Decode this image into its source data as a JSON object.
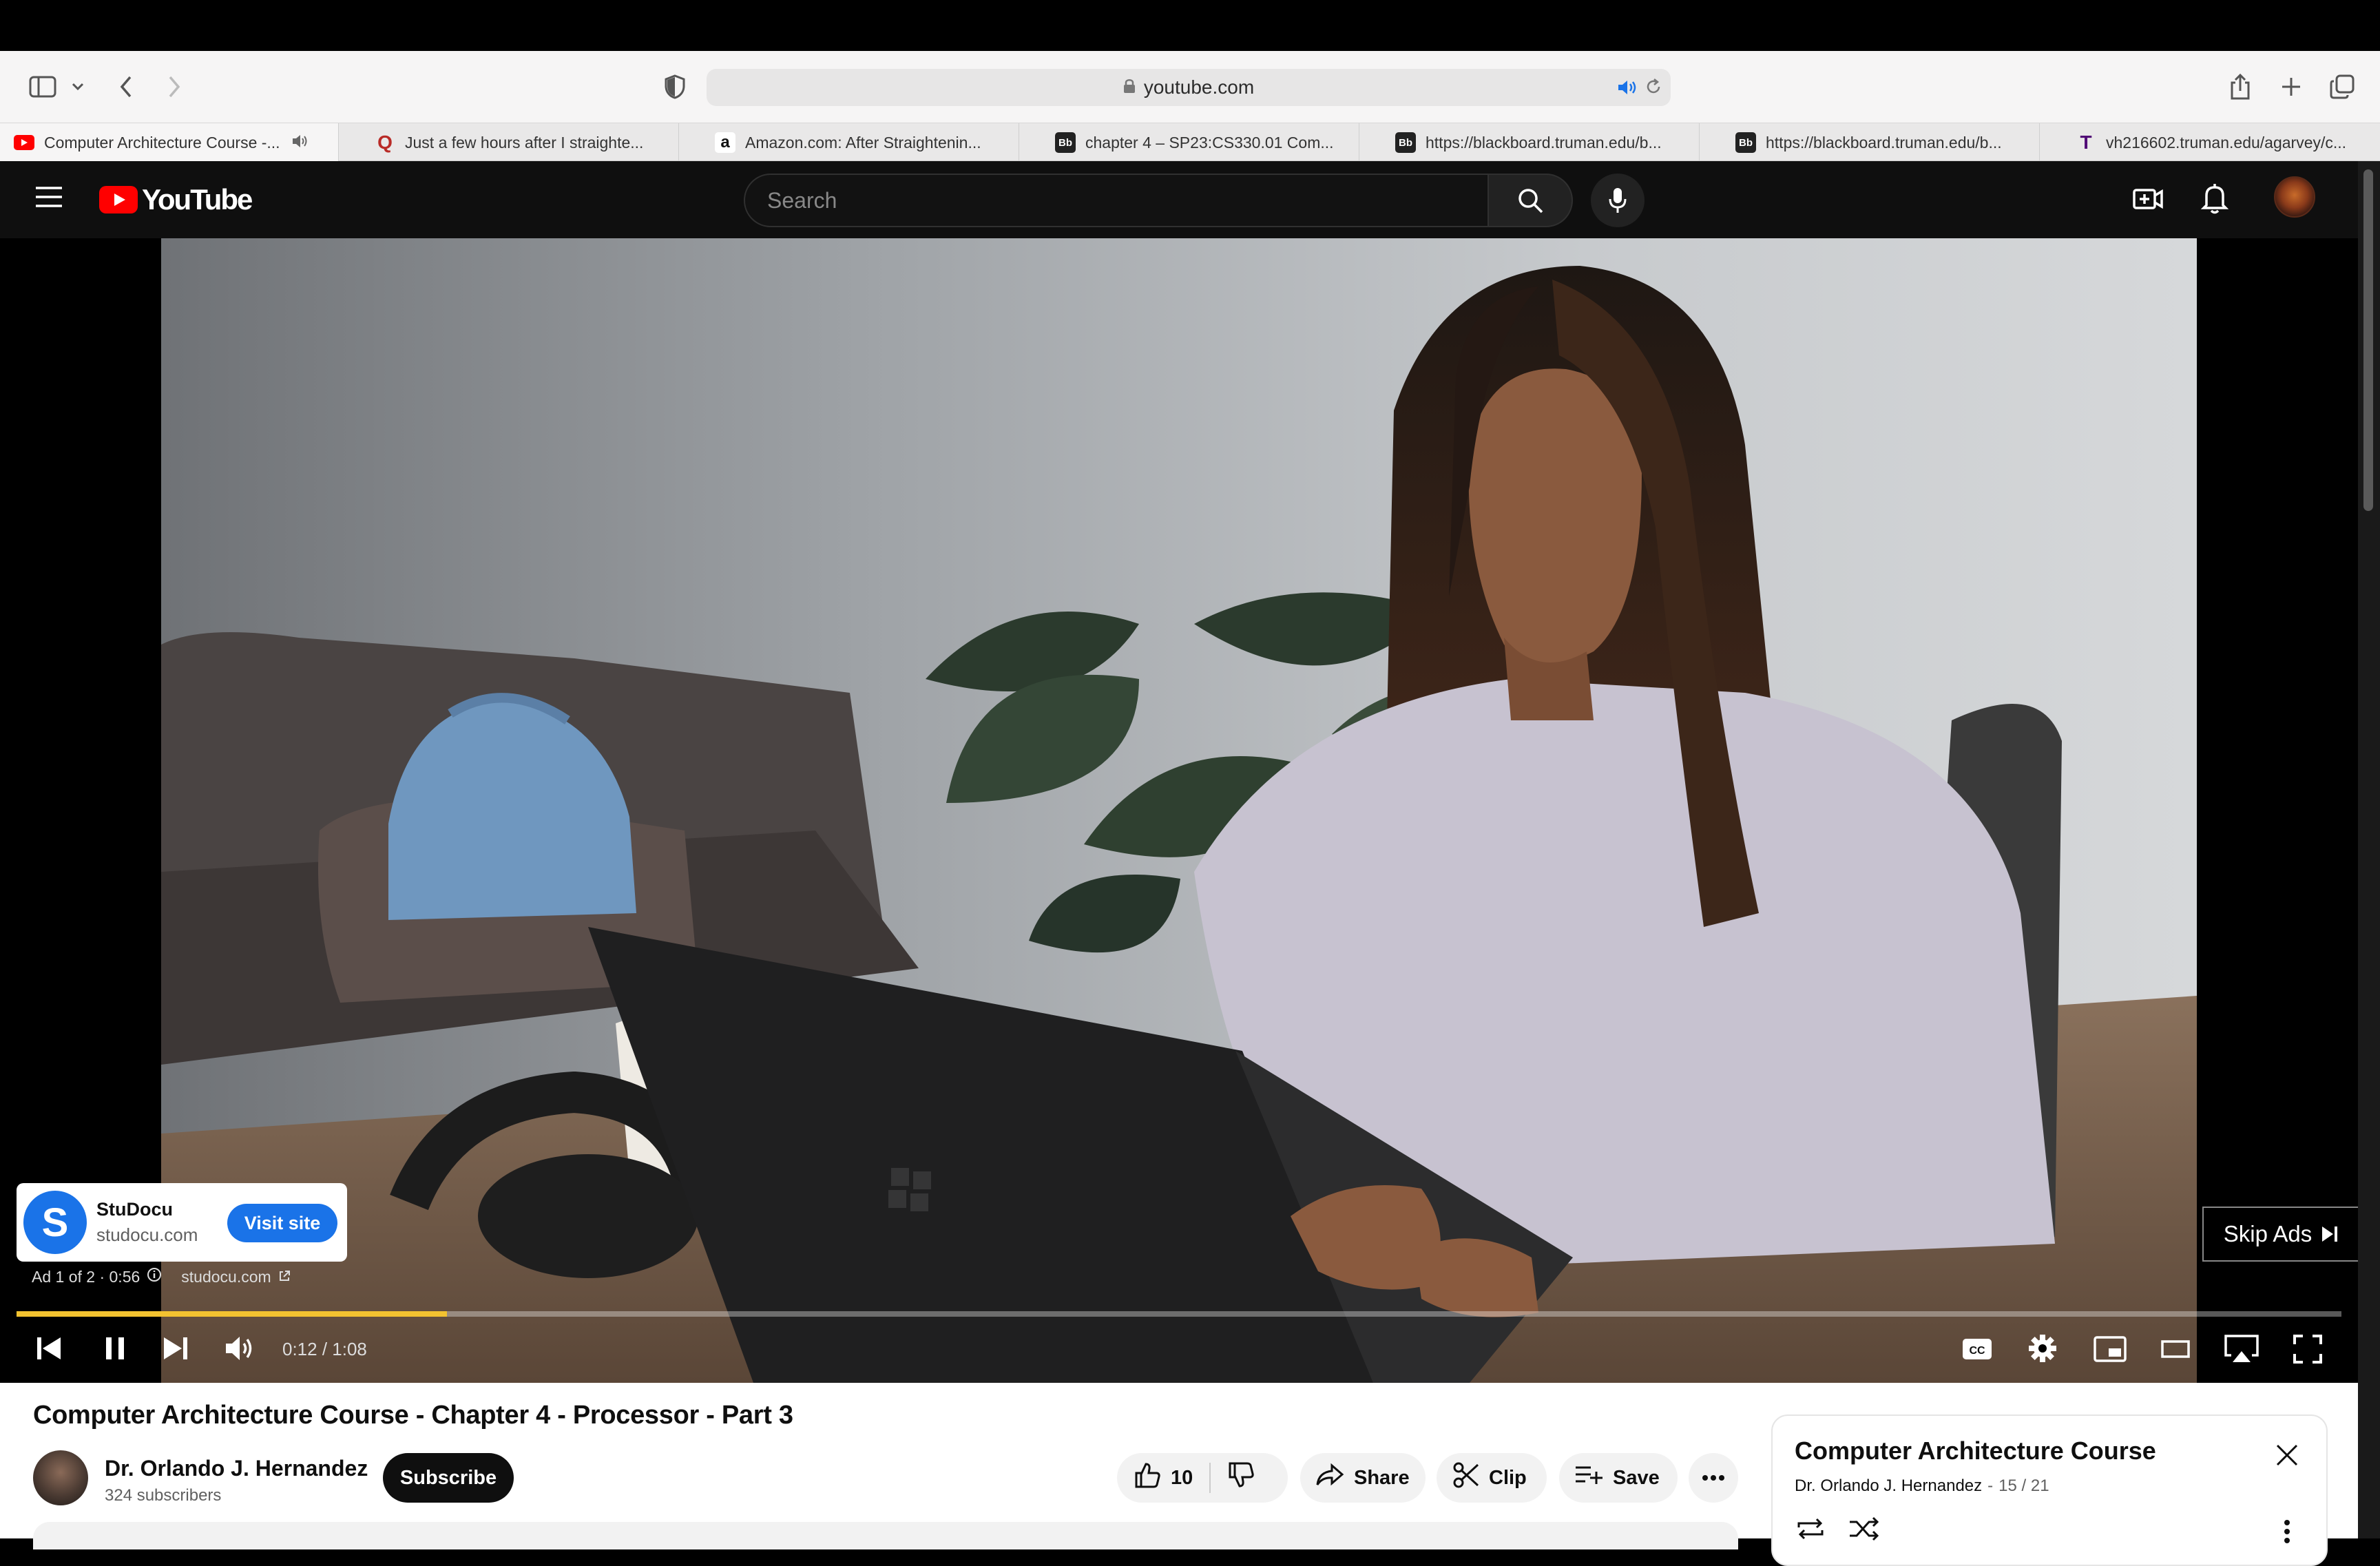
{
  "browser": {
    "url": "youtube.com",
    "tabs": [
      {
        "label": "Computer Architecture Course -...",
        "favicon": "youtube-favicon",
        "active": true
      },
      {
        "label": "Just a few hours after I straighte...",
        "favicon": "quora-favicon"
      },
      {
        "label": "Amazon.com: After Straightenin...",
        "favicon": "amazon-favicon"
      },
      {
        "label": "chapter 4 – SP23:CS330.01 Com...",
        "favicon": "blackboard-favicon"
      },
      {
        "label": "https://blackboard.truman.edu/b...",
        "favicon": "blackboard-favicon"
      },
      {
        "label": "https://blackboard.truman.edu/b...",
        "favicon": "blackboard-favicon"
      },
      {
        "label": "vh216602.truman.edu/agarvey/c...",
        "favicon": "truman-favicon"
      }
    ]
  },
  "youtube": {
    "logo_text": "YouTube",
    "search_placeholder": "Search"
  },
  "ad": {
    "advertiser": "StuDocu",
    "domain": "studocu.com",
    "logo_letter": "S",
    "cta": "Visit site",
    "ad_info": "Ad 1 of 2 · 0:56",
    "link_domain": "studocu.com",
    "skip_label": "Skip Ads"
  },
  "player": {
    "time": "0:12 / 1:08",
    "progress": 0.185
  },
  "video": {
    "title": "Computer Architecture Course - Chapter 4 - Processor - Part 3",
    "channel": "Dr. Orlando J. Hernandez",
    "subscribers": "324 subscribers",
    "subscribe_label": "Subscribe",
    "like_count": "10",
    "share_label": "Share",
    "clip_label": "Clip",
    "save_label": "Save"
  },
  "playlist": {
    "title": "Computer Architecture Course",
    "owner": "Dr. Orlando J. Hernandez",
    "position": "15 / 21"
  },
  "colors": {
    "youtube_red": "#ff0000",
    "ad_blue": "#1a73e8",
    "ad_progress": "#f2c230"
  }
}
